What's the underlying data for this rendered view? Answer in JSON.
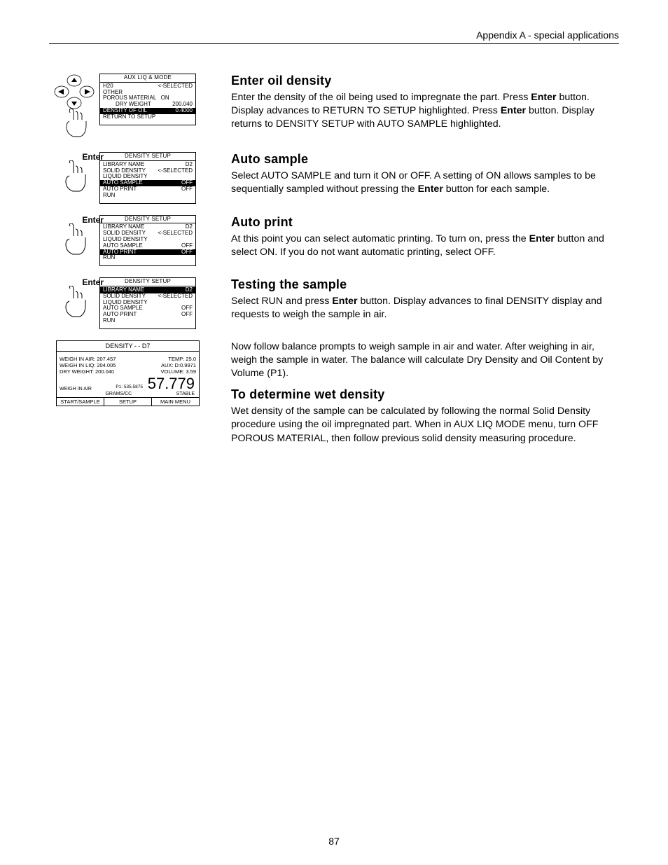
{
  "header": "Appendix A - special applications",
  "page_number": "87",
  "nav": {
    "enter_label": "Enter"
  },
  "lcd1": {
    "title": "AUX LIQ & MODE",
    "rows": [
      {
        "l": "H20",
        "r": "<-SELECTED",
        "hl": false
      },
      {
        "l": "OTHER",
        "r": "",
        "hl": false
      },
      {
        "l": "POROUS MATERIAL   ON",
        "r": "",
        "hl": false
      },
      {
        "l": "DRY WEIGHT",
        "r": "200.040",
        "indent": true,
        "hl": false
      },
      {
        "l": "DENSITY OF OIL",
        "r": "0.4000",
        "indent": true,
        "hl": true
      },
      {
        "l": "RETURN TO SETUP",
        "r": "",
        "hl": false
      }
    ]
  },
  "lcd2": {
    "title": "DENSITY SETUP",
    "rows": [
      {
        "l": "LIBRARY NAME",
        "r": "D2",
        "hl": false
      },
      {
        "l": "SOLID DENSITY",
        "r": "<-SELECTED",
        "hl": false
      },
      {
        "l": "LIQUID DENSITY",
        "r": "",
        "hl": false
      },
      {
        "l": "AUTO SAMPLE",
        "r": "OFF",
        "hl": true
      },
      {
        "l": "AUTO PRINT",
        "r": "OFF",
        "hl": false
      },
      {
        "l": "RUN",
        "r": "",
        "hl": false
      }
    ]
  },
  "lcd3": {
    "title": "DENSITY SETUP",
    "rows": [
      {
        "l": "LIBRARY NAME",
        "r": "D2",
        "hl": false
      },
      {
        "l": "SOLID DENSITY",
        "r": "<-SELECTED",
        "hl": false
      },
      {
        "l": "LIQUID DENSITY",
        "r": "",
        "hl": false
      },
      {
        "l": "AUTO SAMPLE",
        "r": "OFF",
        "hl": false
      },
      {
        "l": "AUTO PRINT",
        "r": "OFF",
        "hl": true
      },
      {
        "l": "RUN",
        "r": "",
        "hl": false
      }
    ]
  },
  "lcd4": {
    "title": "DENSITY SETUP",
    "rows": [
      {
        "l": "LIBRARY NAME",
        "r": "D2",
        "hl": true
      },
      {
        "l": "SOLID DENSITY",
        "r": "<-SELECTED",
        "hl": false
      },
      {
        "l": "LIQUID DENSITY",
        "r": "",
        "hl": false
      },
      {
        "l": "AUTO SAMPLE",
        "r": "OFF",
        "hl": false
      },
      {
        "l": "AUTO PRINT",
        "r": "OFF",
        "hl": false
      },
      {
        "l": "RUN",
        "r": "",
        "hl": false
      }
    ]
  },
  "density": {
    "title": "DENSITY - - D7",
    "lines_l": [
      "WEIGH IN AIR: 207.457",
      "WEIGH IN LIQ: 204.005",
      "DRY WEIGHT:   200.040"
    ],
    "lines_r": [
      "TEMP: 25.0",
      "AUX: D:0.9971",
      "VOLUME: 3.59"
    ],
    "big": "57.779",
    "p1": "P1: 535.5875",
    "weigh_label": "WEIGH IN AIR",
    "units": "GRAMS/CC",
    "stable": "STABLE",
    "buttons": [
      "START/SAMPLE",
      "SETUP",
      "MAIN MENU"
    ]
  },
  "sections": {
    "s1": {
      "title": "Enter oil density",
      "body_parts": [
        "Enter the density of the oil being used to impregnate the part. Press ",
        " button. Display advances to RETURN TO SETUP  highlighted. Press ",
        " button.  Display returns to DENSITY SETUP with AUTO SAMPLE highlighted."
      ],
      "strong": "Enter"
    },
    "s2": {
      "title": "Auto sample",
      "body_parts": [
        "Select AUTO SAMPLE and turn it ON or OFF.  A setting of ON allows samples to be sequentially sampled without pressing the ",
        " button for each sample."
      ],
      "strong": "Enter"
    },
    "s3": {
      "title": "Auto print",
      "body_parts": [
        "At this point you can select automatic printing.  To turn on, press the ",
        " button and select ON.  If you do not want automatic printing, select OFF."
      ],
      "strong": "Enter"
    },
    "s4": {
      "title": "Testing the sample",
      "body_parts": [
        "Select RUN and press ",
        " button. Display advances to final DENSITY display and requests to weigh the sample in air."
      ],
      "strong": "Enter"
    },
    "s5": {
      "body": "Now follow balance prompts to weigh sample in air and water.  After weighing in air, weigh the sample in water.  The balance will calculate Dry Density and Oil Content by Volume (P1)."
    },
    "s6": {
      "title": "To determine wet density",
      "body": "Wet density of the sample can be calculated by following the normal Solid Density procedure using the oil impregnated part.  When in AUX LIQ MODE menu, turn OFF POROUS MATERIAL, then follow previous solid density measuring procedure."
    }
  }
}
